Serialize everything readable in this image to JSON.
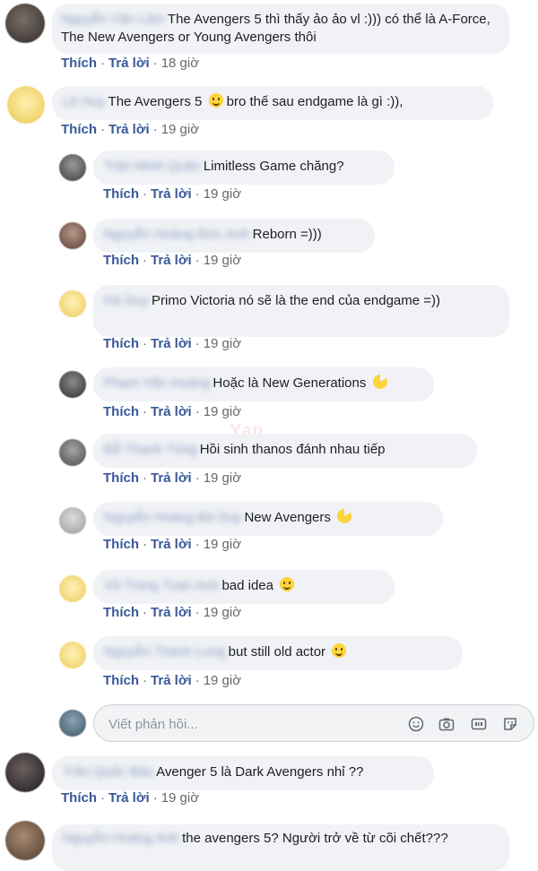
{
  "colors": {
    "link": "#385898",
    "meta": "#65676b",
    "bubble": "#f0f2f5",
    "text": "#1c1e21"
  },
  "actions": {
    "like": "Thích",
    "reply": "Trả lời",
    "sep": "·"
  },
  "comments": [
    {
      "author": "Nguyễn Văn Lâm",
      "text": "The Avengers 5 thì thấy ảo ảo vl :))) có thể là A-Force, The New Avengers or Young Avengers thôi",
      "time": "18 giờ"
    },
    {
      "author": "Lê Huy",
      "text_before": "The Avengers 5",
      "text_after": "bro thế sau endgame là gì :)),",
      "time": "19 giờ"
    },
    {
      "author": "Trần Minh Quân",
      "text": "Limitless Game chăng?",
      "time": "19 giờ"
    },
    {
      "author": "Nguyễn Hoàng Đức Anh",
      "text": "Reborn =)))",
      "time": "19 giờ"
    },
    {
      "author": "Hà Duy",
      "text": "Primo Victoria nó sẽ là the end của endgame =))",
      "time": "19 giờ"
    },
    {
      "author": "Phạm Văn Hoàng",
      "text": "Hoặc là New Generations",
      "time": "19 giờ"
    },
    {
      "author": "Đỗ Thanh Tùng",
      "text": "Hồi sinh thanos đánh nhau tiếp",
      "time": "19 giờ"
    },
    {
      "author": "Nguyễn Hoàng Bá Duy",
      "text": "New Avengers",
      "time": "19 giờ"
    },
    {
      "author": "Vũ Trọng Tuan Anh",
      "text": "bad idea",
      "time": "19 giờ"
    },
    {
      "author": "Nguyễn Thành Long",
      "text": "but still old actor",
      "time": "19 giờ"
    },
    {
      "author": "Trần Quốc Bảo",
      "text": "Avenger 5 là Dark Avengers nhỉ ??",
      "time": "19 giờ"
    },
    {
      "author": "Nguyễn Hoàng Anh",
      "text": "the avengers 5? Người trở về từ cõi chết???",
      "time": ""
    }
  ],
  "reply_box": {
    "placeholder": "Viết phản hồi...",
    "icons": [
      "emoji-icon",
      "camera-icon",
      "gif-icon",
      "sticker-icon"
    ]
  },
  "watermark": "Yan"
}
